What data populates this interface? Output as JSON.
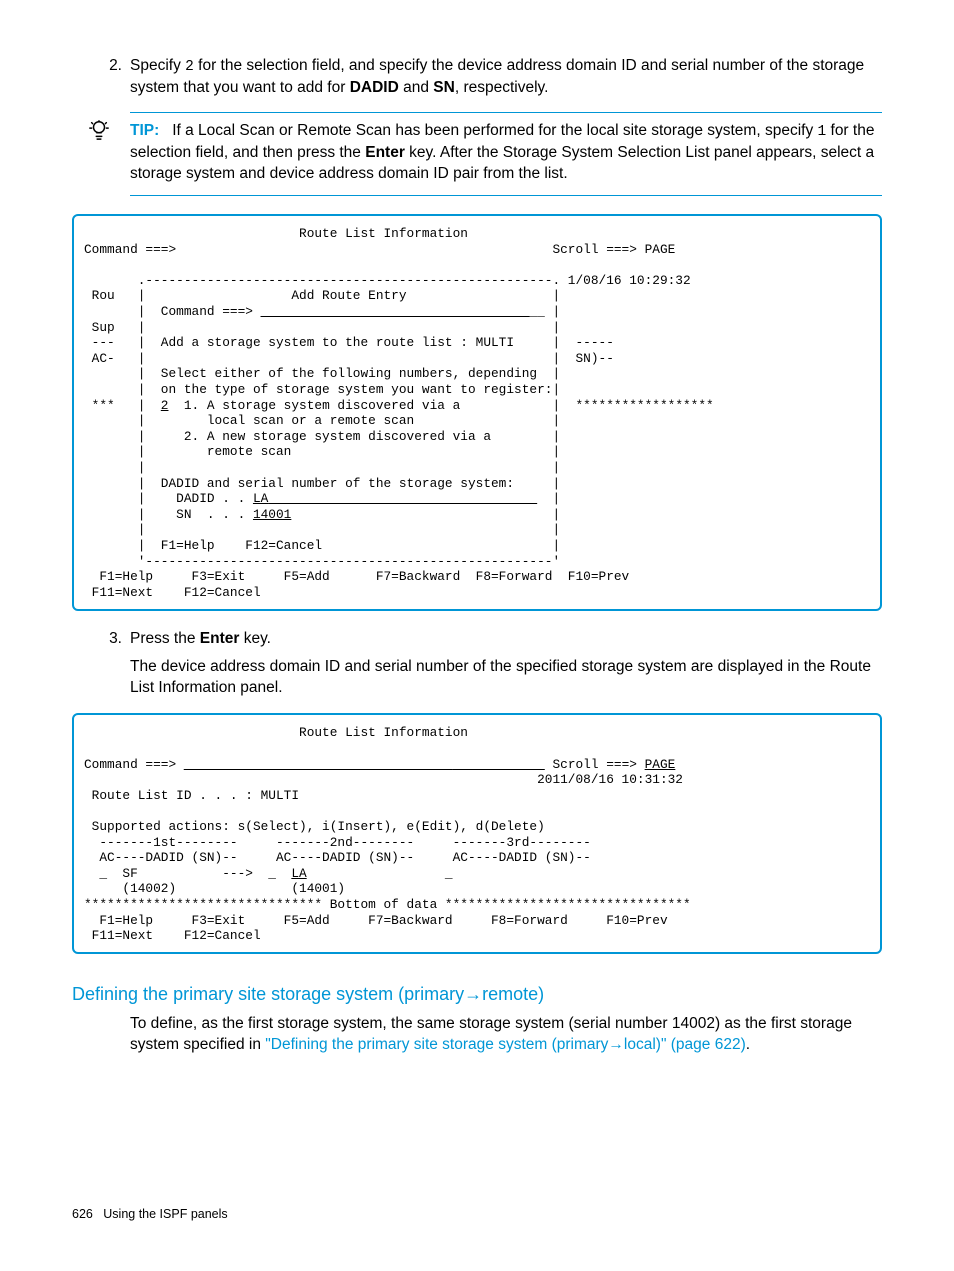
{
  "step2": {
    "num": "2.",
    "text_a": "Specify ",
    "code_2": "2",
    "text_b": " for the selection field, and specify the device address domain ID and serial number of the storage system that you want to add for ",
    "dadid": "DADID",
    "text_c": " and ",
    "sn": "SN",
    "text_d": ", respectively."
  },
  "tip": {
    "label": "TIP:",
    "text_a": "If a Local Scan or Remote Scan has been performed for the local site storage system, specify ",
    "code_1": "1",
    "text_b": " for the selection field, and then press the ",
    "enter": "Enter",
    "text_c": " key. After the Storage System Selection List panel appears, select a storage system and device address domain ID pair from the list."
  },
  "term1_lines": [
    "                            Route List Information",
    "Command ===>                                                 Scroll ===> PAGE",
    "",
    "       .-----------------------------------------------------. 1/08/16 10:29:32",
    " Rou   |                   Add Route Entry                   |",
    "       |  Command ===> _____________________________________ |",
    " Sup   |                                                     |",
    " ---   |  Add a storage system to the route list : MULTI     |  -----",
    " AC-   |                                                     |  SN)--",
    "       |  Select either of the following numbers, depending  |",
    "       |  on the type of storage system you want to register:|",
    " ***   |  2  1. A storage system discovered via a            |  ******************",
    "       |        local scan or a remote scan                  |",
    "       |     2. A new storage system discovered via a        |",
    "       |        remote scan                                  |",
    "       |                                                     |",
    "       |  DADID and serial number of the storage system:     |",
    "       |    DADID . . LA___________________________________  |",
    "       |    SN  . . . 14001                                  |",
    "       |                                                     |",
    "       |  F1=Help    F12=Cancel                              |",
    "       '-----------------------------------------------------'",
    "  F1=Help     F3=Exit     F5=Add      F7=Backward  F8=Forward  F10=Prev",
    " F11=Next    F12=Cancel"
  ],
  "step3": {
    "num": "3.",
    "text_a": "Press the ",
    "enter": "Enter",
    "text_b": " key.",
    "para": "The device address domain ID and serial number of the specified storage system are displayed in the Route List Information panel."
  },
  "term2_lines": [
    "                            Route List Information",
    "",
    "Command ===> _______________________________________________ Scroll ===> PAGE",
    "                                                           2011/08/16 10:31:32",
    " Route List ID . . . : MULTI",
    "",
    " Supported actions: s(Select), i(Insert), e(Edit), d(Delete)",
    "  -------1st--------     -------2nd--------     -------3rd--------",
    "  AC----DADID (SN)--     AC----DADID (SN)--     AC----DADID (SN)--",
    "  _  SF           --->  _  LA                  _",
    "     (14002)               (14001)",
    "******************************* Bottom of data ********************************",
    "  F1=Help     F3=Exit     F5=Add     F7=Backward     F8=Forward     F10=Prev",
    " F11=Next    F12=Cancel"
  ],
  "section": {
    "heading": "Defining the primary site storage system (primary→remote)",
    "text_a": "To define, as the first storage system, the same storage system (serial number 14002) as the first storage system specified in ",
    "link": "\"Defining the primary site storage system (primary→local)\" (page 622)",
    "text_b": "."
  },
  "footer": {
    "page": "626",
    "title": "Using the ISPF panels"
  }
}
